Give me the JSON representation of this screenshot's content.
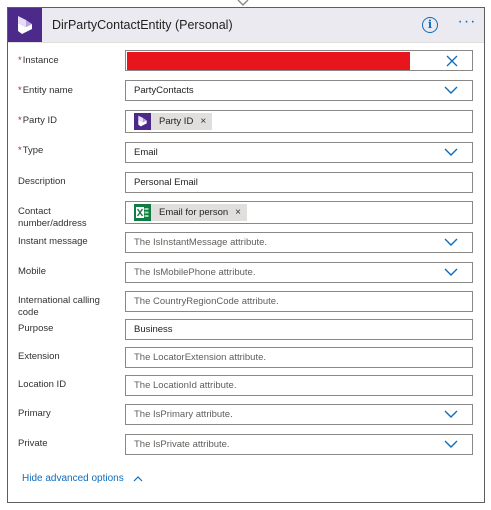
{
  "card": {
    "title": "DirPartyContactEntity (Personal)",
    "info_symbol": "i",
    "more_symbol": "···"
  },
  "fields": {
    "instance": {
      "label": "Instance",
      "required": true,
      "redacted": true
    },
    "entity_name": {
      "label": "Entity name",
      "required": true,
      "value": "PartyContacts"
    },
    "party_id": {
      "label": "Party ID",
      "required": true,
      "token_label": "Party ID"
    },
    "type": {
      "label": "Type",
      "required": true,
      "value": "Email"
    },
    "description": {
      "label": "Description",
      "value": "Personal Email"
    },
    "contact": {
      "label_line1": "Contact",
      "label_line2": "number/address",
      "token_label": "Email for person"
    },
    "instant_message": {
      "label": "Instant message",
      "placeholder": "The IsInstantMessage attribute."
    },
    "mobile": {
      "label": "Mobile",
      "placeholder": "The IsMobilePhone attribute."
    },
    "intl_code": {
      "label_line1": "International calling",
      "label_line2": "code",
      "placeholder": "The CountryRegionCode attribute."
    },
    "purpose": {
      "label": "Purpose",
      "value": "Business"
    },
    "extension": {
      "label": "Extension",
      "placeholder": "The LocatorExtension attribute."
    },
    "location_id": {
      "label": "Location ID",
      "placeholder": "The LocationId attribute."
    },
    "primary": {
      "label": "Primary",
      "placeholder": "The IsPrimary attribute."
    },
    "private": {
      "label": "Private",
      "placeholder": "The IsPrivate attribute."
    }
  },
  "required_marker": "*",
  "token_close": "×",
  "footer": {
    "advanced_label": "Hide advanced options"
  },
  "colors": {
    "accent": "#0f6cbd",
    "header_bg": "#ebeaf0",
    "app_icon_bg": "#4b2a8a",
    "excel_green": "#107c41",
    "required": "#a4262c",
    "redaction": "#e8151d"
  }
}
